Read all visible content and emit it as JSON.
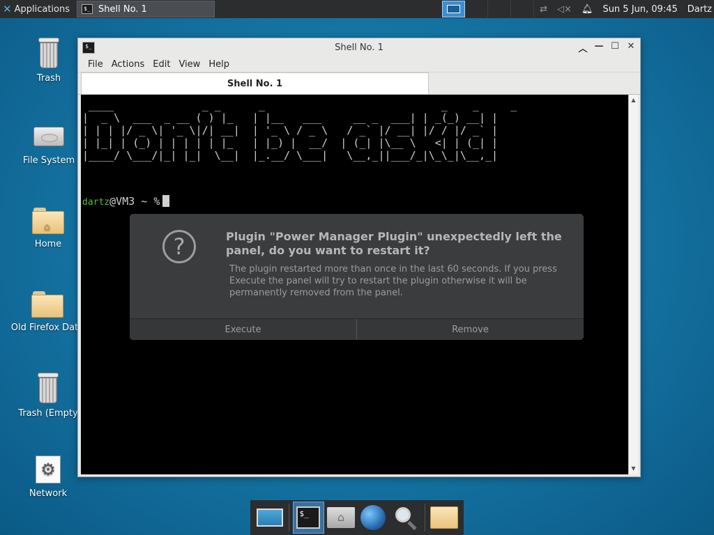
{
  "top_panel": {
    "applications_label": "Applications",
    "task_title": "Shell No. 1",
    "clock": "Sun  5 Jun, 09:45",
    "user": "Dartz"
  },
  "desktop_icons": [
    {
      "label": "Trash",
      "icon": "trash-icon"
    },
    {
      "label": "File System",
      "icon": "drive-icon"
    },
    {
      "label": "Home",
      "icon": "home-folder-icon"
    },
    {
      "label": "Old Firefox Data",
      "icon": "folder-icon"
    },
    {
      "label": "Trash (Empty",
      "icon": "trash-icon"
    },
    {
      "label": "Network",
      "icon": "network-icon"
    }
  ],
  "terminal": {
    "window_title": "Shell No. 1",
    "menu": [
      "File",
      "Actions",
      "Edit",
      "View",
      "Help"
    ],
    "tab_title": "Shell No. 1",
    "ascii_banner": " ____              _ _      _                            _    _     _ \n|  _ \\  ___  _ __ ( ) |_   | |__   ___     __ _  ___| | _(_) __| |\n| | | |/ _ \\| '_ \\|/| __|  | '_ \\ / _ \\   / _` |/ __| |/ / |/ _` |\n| |_| | (_) | | | | | |_   | |_) |  __/  | (_| |\\__ \\   <| | (_| |\n|____/ \\___/|_| |_|  \\__|  |_.__/ \\___|   \\__,_||___/_|\\_\\_|\\__,_|",
    "prompt_user": "dartz",
    "prompt_rest": "@VM3 ~ %"
  },
  "dialog": {
    "title": "Plugin \"Power Manager Plugin\" unexpectedly left the panel, do you want to restart it?",
    "body": "The plugin restarted more than once in the last 60 seconds. If you press Execute the panel will try to restart the plugin otherwise it will be permanently removed from the panel.",
    "execute_label": "Execute",
    "remove_label": "Remove"
  },
  "colors": {
    "desktop_bg": "#1677a6",
    "panel_bg": "#2b2d2f",
    "prompt_user": "#4fbf3f",
    "dialog_bg": "#3b3c3d"
  }
}
